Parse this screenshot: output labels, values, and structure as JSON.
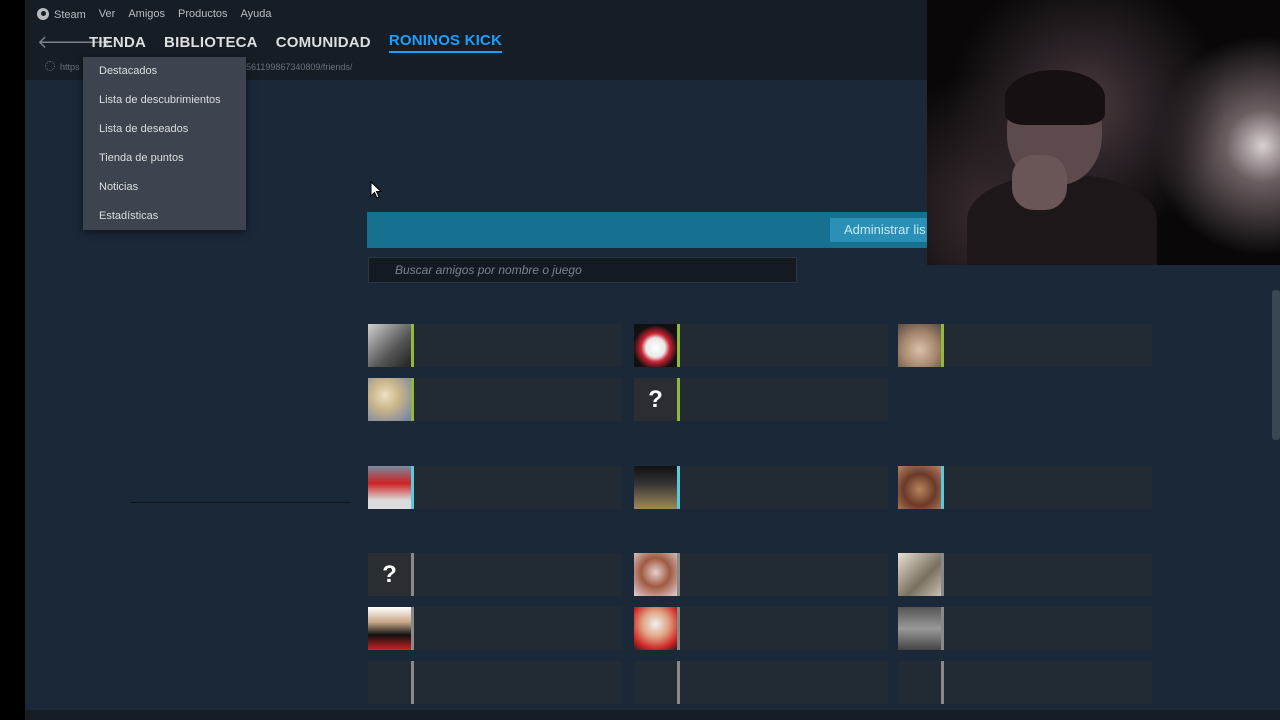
{
  "menubar": {
    "steam": "Steam",
    "items": [
      "Ver",
      "Amigos",
      "Productos",
      "Ayuda"
    ]
  },
  "nav": {
    "back_icon": "arrow-left-icon",
    "forward_icon": "arrow-right-icon",
    "tabs": [
      "TIENDA",
      "BIBLIOTECA",
      "COMUNIDAD",
      "RONINOS KICK"
    ],
    "active_tab": "RONINOS KICK"
  },
  "url": {
    "prefix": "https",
    "suffix": "561199867340809/friends/"
  },
  "dropdown": {
    "items": [
      "Destacados",
      "Lista de descubrimientos",
      "Lista de deseados",
      "Tienda de puntos",
      "Noticias",
      "Estadísticas"
    ]
  },
  "friends_header": {
    "admin_button": "Administrar lis"
  },
  "search": {
    "placeholder": "Buscar amigos por nombre o juego"
  },
  "colors": {
    "background": "#1b2838",
    "accent": "#1a9fff",
    "in_game": "#90ba3c",
    "online": "#57cbde",
    "offline": "#898989"
  },
  "friends": [
    {
      "avatar": "landscape-avatar",
      "status": "in_game"
    },
    {
      "avatar": "masked-character-avatar",
      "status": "in_game"
    },
    {
      "avatar": "cat-avatar",
      "status": "in_game"
    },
    {
      "avatar": "blonde-character-avatar",
      "status": "in_game"
    },
    {
      "avatar": "question-mark-avatar",
      "status": "in_game",
      "glyph": "?"
    },
    {
      "avatar": "red-jacket-avatar",
      "status": "online"
    },
    {
      "avatar": "railway-star-avatar",
      "status": "online"
    },
    {
      "avatar": "bandit-avatar",
      "status": "online"
    },
    {
      "avatar": "question-mark-avatar",
      "status": "offline",
      "glyph": "?"
    },
    {
      "avatar": "anime-girl-avatar",
      "status": "offline"
    },
    {
      "avatar": "cat-sketch-avatar",
      "status": "offline"
    },
    {
      "avatar": "suited-man-avatar",
      "status": "offline"
    },
    {
      "avatar": "fox-mask-avatar",
      "status": "offline"
    },
    {
      "avatar": "statue-avatar",
      "status": "offline"
    },
    {
      "avatar": "empty-avatar",
      "status": "offline"
    },
    {
      "avatar": "empty-avatar",
      "status": "offline"
    },
    {
      "avatar": "empty-avatar",
      "status": "offline"
    }
  ]
}
